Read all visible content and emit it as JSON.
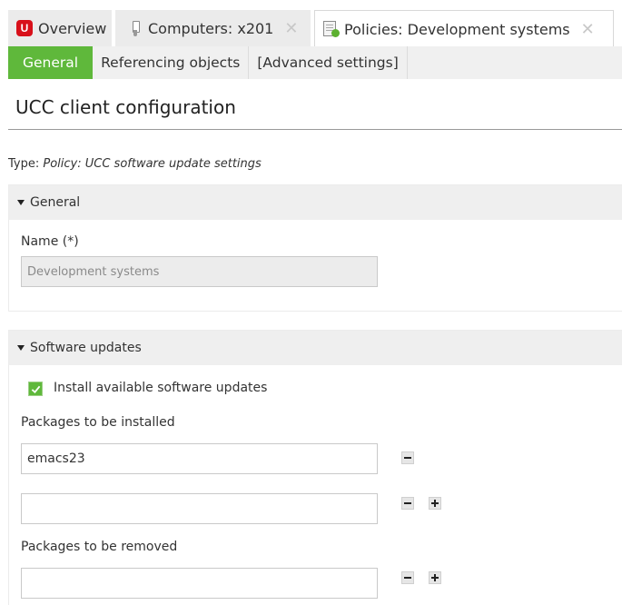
{
  "tabs": [
    {
      "label": "Overview",
      "icon": "univention-logo-icon",
      "icon_text": "U"
    },
    {
      "label": "Computers: x201",
      "icon": "usb-stick-icon",
      "close": "✕"
    },
    {
      "label": "Policies: Development systems",
      "icon": "policy-document-icon",
      "close": "✕"
    }
  ],
  "subtabs": [
    "General",
    "Referencing objects",
    "[Advanced settings]"
  ],
  "page_title": "UCC client configuration",
  "type": {
    "prefix": "Type: ",
    "value": "Policy: UCC software update settings"
  },
  "general_section": {
    "title": "General",
    "name_label": "Name (*)",
    "name_value": "Development systems"
  },
  "software_section": {
    "title": "Software updates",
    "install_label": "Install available software updates",
    "install_checked": true,
    "packages_install_label": "Packages to be installed",
    "packages_install": [
      "emacs23",
      ""
    ],
    "packages_remove_label": "Packages to be removed",
    "packages_remove": [
      ""
    ]
  },
  "colors": {
    "accent": "#5fb83b",
    "logo": "#d8101a"
  }
}
